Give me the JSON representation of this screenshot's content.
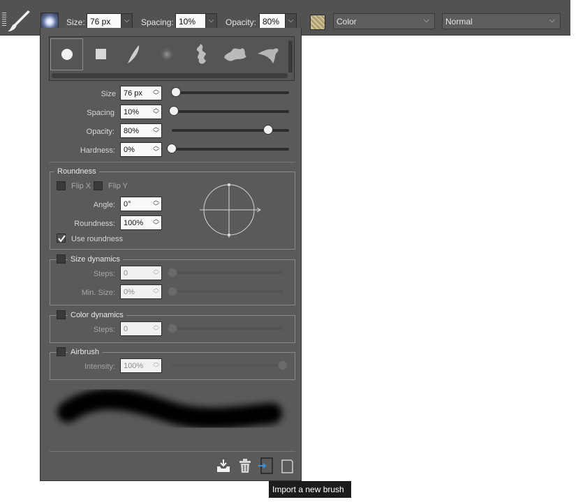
{
  "toolbar": {
    "size_label": "Size:",
    "size_value": "76 px",
    "spacing_label": "Spacing:",
    "spacing_value": "10%",
    "opacity_label": "Opacity:",
    "opacity_value": "80%",
    "color_mode": "Color",
    "blend_mode": "Normal",
    "dropdown_glyph": "⌵"
  },
  "brush_presets": [
    "round-brush",
    "square-brush",
    "feather-brush",
    "soft-round-brush",
    "smoke-brush",
    "cloud-brush",
    "splash-brush"
  ],
  "settings": {
    "size": {
      "label": "Size",
      "value": "76 px",
      "level": 0.0
    },
    "spacing": {
      "label": "Spacing",
      "value": "10%",
      "level": 0.0
    },
    "opacity": {
      "label": "Opacity:",
      "value": "80%",
      "level": 0.8
    },
    "hardness": {
      "label": "Hardness:",
      "value": "0%",
      "level": 0.0
    }
  },
  "roundness": {
    "title": "Roundness",
    "flip_x": "Flip X",
    "flip_y": "Flip Y",
    "angle_label": "Angle:",
    "angle_value": "0°",
    "roundness_label": "Roundness:",
    "roundness_value": "100%",
    "use_roundness": "Use roundness",
    "use_roundness_checked": true
  },
  "size_dynamics": {
    "title": "Size dynamics",
    "steps_label": "Steps:",
    "steps_value": "0",
    "min_size_label": "Min. Size:",
    "min_size_value": "0%"
  },
  "color_dynamics": {
    "title": "Color dynamics",
    "steps_label": "Steps:",
    "steps_value": "0"
  },
  "airbrush": {
    "title": "Airbrush",
    "intensity_label": "Intensity:",
    "intensity_value": "100%",
    "level": 1.0
  },
  "footer": {
    "buttons": [
      "save-brush-icon",
      "delete-brush-icon",
      "import-brush-icon",
      "new-brush-icon"
    ],
    "tooltip": "Import a new brush"
  },
  "colors": {
    "toolbar_bg": "#525252",
    "panel_bg": "#5a5a5a",
    "import_accent": "#3d8fd6"
  }
}
